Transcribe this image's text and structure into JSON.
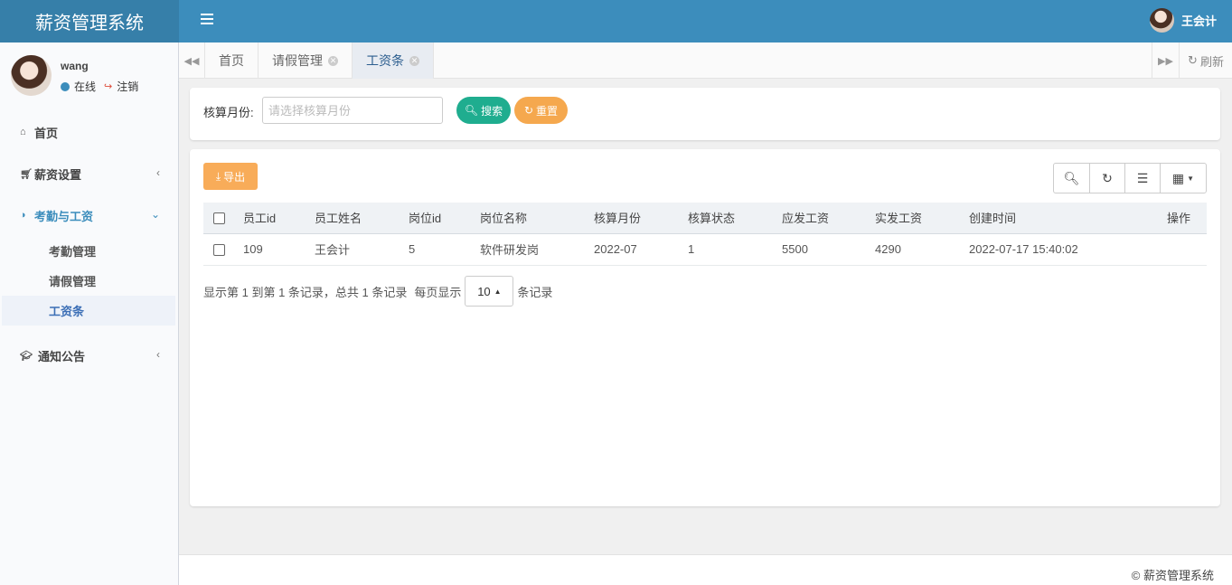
{
  "app": {
    "brand": "薪资管理系统"
  },
  "topbar": {
    "username": "王会计"
  },
  "sidebar": {
    "user": {
      "name": "wang",
      "status": "在线",
      "logout": "注销"
    },
    "menu": [
      {
        "label": "首页",
        "icon": "home-icon"
      },
      {
        "label": "薪资设置",
        "icon": "cart-icon"
      },
      {
        "label": "考勤与工资",
        "icon": "half-circle-icon",
        "active": true,
        "children": [
          {
            "label": "考勤管理"
          },
          {
            "label": "请假管理"
          },
          {
            "label": "工资条",
            "current": true
          }
        ]
      },
      {
        "label": "通知公告",
        "icon": "graduation-cap-icon"
      }
    ]
  },
  "tabs": {
    "items": [
      {
        "label": "首页"
      },
      {
        "label": "请假管理"
      },
      {
        "label": "工资条",
        "active": true
      }
    ],
    "refresh_label": "刷新"
  },
  "search": {
    "label": "核算月份:",
    "placeholder": "请选择核算月份",
    "search_button": "搜索",
    "reset_button": "重置"
  },
  "toolbar": {
    "export_button": "导出"
  },
  "table": {
    "columns": [
      "员工id",
      "员工姓名",
      "岗位id",
      "岗位名称",
      "核算月份",
      "核算状态",
      "应发工资",
      "实发工资",
      "创建时间",
      "操作"
    ],
    "rows": [
      [
        "109",
        "王会计",
        "5",
        "软件研发岗",
        "2022-07",
        "1",
        "5500",
        "4290",
        "2022-07-17 15:40:02",
        ""
      ]
    ]
  },
  "pagination": {
    "summary": "显示第 1 到第 1 条记录，总共 1 条记录",
    "per_page_prefix": "每页显示",
    "page_size": "10",
    "per_page_suffix": "条记录"
  },
  "footer": {
    "copyright": "© 薪资管理系统"
  },
  "colors": {
    "header": "#3c8dbc",
    "brand_bg": "#367fa9",
    "search_button": "#1fad8f",
    "reset_button": "#f5a84e",
    "export_button": "#f8ac59"
  }
}
